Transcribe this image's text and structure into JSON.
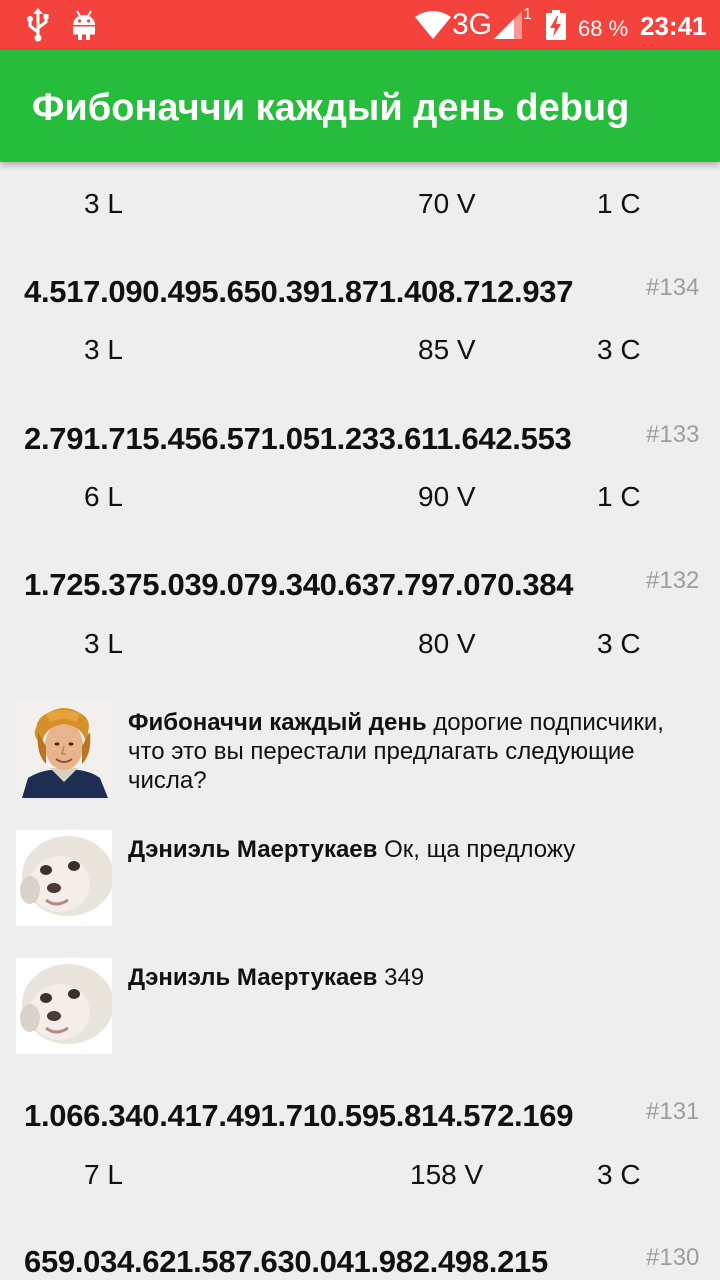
{
  "status_bar": {
    "network": "3G",
    "sim_slot": "1",
    "battery": "68 %",
    "time": "23:41",
    "color": "#f4433c"
  },
  "app_bar": {
    "title": "Фибоначчи каждый день debug",
    "color": "#26bd3d"
  },
  "top_stats": {
    "l": "3 L",
    "v": "70 V",
    "c": "1 C"
  },
  "numbers": [
    {
      "value": "4.517.090.495.650.391.871.408.712.937",
      "index": "#134",
      "l": "3 L",
      "v": "85 V",
      "c": "3 C"
    },
    {
      "value": "2.791.715.456.571.051.233.611.642.553",
      "index": "#133",
      "l": "6 L",
      "v": "90 V",
      "c": "1 C"
    },
    {
      "value": "1.725.375.039.079.340.637.797.070.384",
      "index": "#132",
      "l": "3 L",
      "v": "80 V",
      "c": "3 C"
    },
    {
      "value": "1.066.340.417.491.710.595.814.572.169",
      "index": "#131",
      "l": "7 L",
      "v": "158 V",
      "c": "3 C"
    },
    {
      "value": "659.034.621.587.630.041.982.498.215",
      "index": "#130"
    }
  ],
  "comments": [
    {
      "author": "Фибоначчи каждый день",
      "text": "дорогие подписчики, что это вы перестали предлагать следующие числа?",
      "avatar": "fibonacci-portrait"
    },
    {
      "author": "Дэниэль Маертукаев",
      "text": "Ок, ща предложу",
      "avatar": "white-dog-face"
    },
    {
      "author": "Дэниэль Маертукаев",
      "text": "349",
      "avatar": "white-dog-face"
    }
  ]
}
